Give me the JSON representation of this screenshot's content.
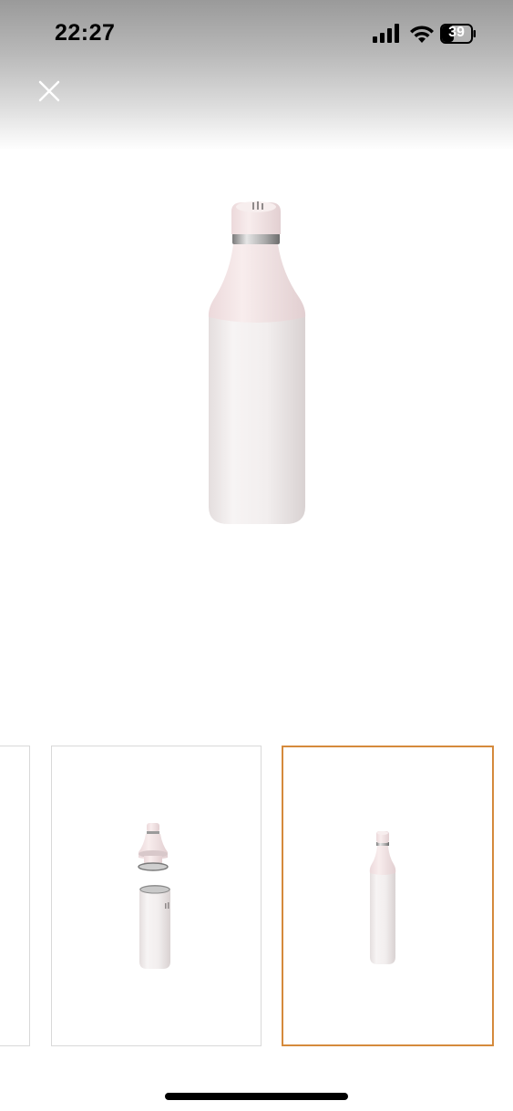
{
  "status_bar": {
    "time": "22:27",
    "battery_level": "39",
    "signal_icon": "cellular-signal-icon",
    "wifi_icon": "wifi-icon",
    "battery_icon": "battery-icon"
  },
  "header": {
    "close_icon": "close-icon"
  },
  "gallery": {
    "selected_index": 2,
    "accent_color": "#d58a3c",
    "thumbnails": [
      {
        "id": "thumb-partial"
      },
      {
        "id": "thumb-disassembled-bottle"
      },
      {
        "id": "thumb-assembled-bottle"
      }
    ]
  }
}
